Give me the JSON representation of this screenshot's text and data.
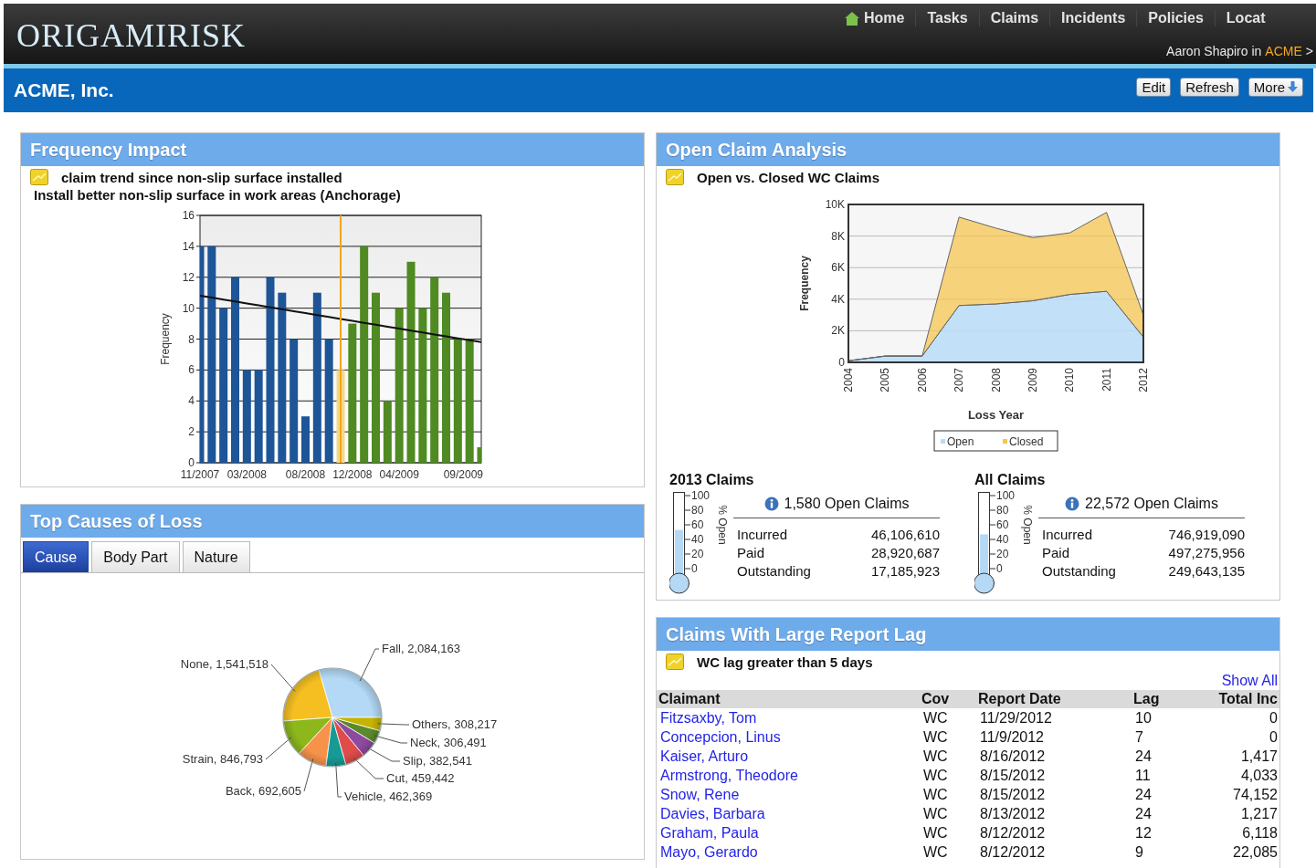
{
  "header": {
    "logo": "ORIGAMIRISK",
    "nav": [
      {
        "label": "Home"
      },
      {
        "label": "Tasks"
      },
      {
        "label": "Claims"
      },
      {
        "label": "Incidents"
      },
      {
        "label": "Policies"
      },
      {
        "label": "Locat"
      }
    ],
    "user": "Aaron Shapiro in",
    "org": "ACME",
    "trail": ">"
  },
  "company_bar": {
    "title": "ACME, Inc.",
    "buttons": [
      {
        "label": "Edit"
      },
      {
        "label": "Refresh"
      },
      {
        "label": "More",
        "menu": true
      }
    ]
  },
  "frequency_impact": {
    "title": "Frequency Impact",
    "note": "claim trend since non-slip surface installed",
    "subtitle": "Install better non-slip surface in work areas (Anchorage)",
    "chart_data": {
      "type": "bar",
      "ylabel": "Frequency",
      "grid": true,
      "categories": [
        "11/2007",
        null,
        null,
        null,
        "03/2008",
        null,
        null,
        null,
        null,
        "08/2008",
        null,
        null,
        null,
        "12/2008",
        null,
        null,
        null,
        "04/2009",
        null,
        null,
        null,
        null,
        "09/2009",
        null,
        null
      ],
      "ylim": [
        0,
        16
      ],
      "series": [
        {
          "color": "#1d5597",
          "values": [
            14,
            14,
            10,
            12,
            6,
            6,
            12,
            11,
            8,
            3,
            11,
            8,
            null,
            null,
            null,
            null,
            null,
            null,
            null,
            null,
            null,
            null,
            null,
            null,
            null
          ]
        },
        {
          "color": "#f3d98a",
          "values": [
            null,
            null,
            null,
            null,
            null,
            null,
            null,
            null,
            null,
            null,
            null,
            null,
            6,
            null,
            null,
            null,
            null,
            null,
            null,
            null,
            null,
            null,
            null,
            null,
            null
          ]
        },
        {
          "color": "#4f8a22",
          "values": [
            null,
            null,
            null,
            null,
            null,
            null,
            null,
            null,
            null,
            null,
            null,
            null,
            null,
            9,
            14,
            11,
            4,
            10,
            13,
            10,
            12,
            11,
            8,
            8,
            1
          ]
        },
        {
          "type": "line",
          "color": "#111111",
          "values": [
            10.8,
            10.68,
            10.55,
            10.43,
            10.3,
            10.18,
            10.05,
            9.93,
            9.8,
            9.68,
            9.55,
            9.43,
            9.3,
            9.18,
            9.05,
            8.93,
            8.8,
            8.68,
            8.55,
            8.43,
            8.3,
            8.18,
            8.05,
            7.93,
            7.8
          ]
        }
      ],
      "yticks": [
        {
          "value": 0,
          "label": "0"
        },
        {
          "value": 2,
          "label": "2"
        },
        {
          "value": 4,
          "label": "4"
        },
        {
          "value": 6,
          "label": "6"
        },
        {
          "value": 8,
          "label": "8"
        },
        {
          "value": 10,
          "label": "10"
        },
        {
          "value": 12,
          "label": "12"
        },
        {
          "value": 14,
          "label": "14"
        },
        {
          "value": 16,
          "label": "16"
        }
      ]
    }
  },
  "open_claim_analysis": {
    "title": "Open Claim Analysis",
    "note": "Open vs. Closed WC Claims",
    "chart_data": {
      "type": "area",
      "stacked": true,
      "grid": true,
      "legend": true,
      "xlabel": "Loss Year",
      "ylabel": "Frequency",
      "x": [
        2004,
        2005,
        2006,
        2007,
        2008,
        2009,
        2010,
        2011,
        2012
      ],
      "xlim": [
        2004,
        2012
      ],
      "ylim": [
        0,
        10000
      ],
      "series": [
        {
          "name": "Open",
          "color": "#b8dcf7",
          "values": [
            100,
            400,
            400,
            3600,
            3700,
            3900,
            4300,
            4500,
            1600
          ]
        },
        {
          "name": "Closed",
          "color": "#f6c650",
          "values": [
            0,
            0,
            0,
            5600,
            4800,
            4000,
            3900,
            5000,
            1400
          ]
        }
      ],
      "xticks": [
        2004,
        2005,
        2006,
        2007,
        2008,
        2009,
        2010,
        2011,
        2012
      ],
      "yticks": [
        {
          "value": 0,
          "label": "0"
        },
        {
          "value": 2000,
          "label": "2K"
        },
        {
          "value": 4000,
          "label": "4K"
        },
        {
          "value": 6000,
          "label": "6K"
        },
        {
          "value": 8000,
          "label": "8K"
        },
        {
          "value": 10000,
          "label": "10K"
        }
      ]
    },
    "gauges": [
      {
        "title": "2013 Claims",
        "level": 0.53,
        "scale": [
          "100",
          "80",
          "60",
          "40",
          "20",
          "0"
        ],
        "axis_label": "% Open",
        "open_claims": "1,580 Open Claims",
        "rows": [
          {
            "label": "Incurred",
            "value": "46,106,610"
          },
          {
            "label": "Paid",
            "value": "28,920,687"
          },
          {
            "label": "Outstanding",
            "value": "17,185,923"
          }
        ]
      },
      {
        "title": "All Claims",
        "level": 0.47,
        "scale": [
          "100",
          "80",
          "60",
          "40",
          "20",
          "0"
        ],
        "axis_label": "% Open",
        "open_claims": "22,572 Open Claims",
        "rows": [
          {
            "label": "Incurred",
            "value": "746,919,090"
          },
          {
            "label": "Paid",
            "value": "497,275,956"
          },
          {
            "label": "Outstanding",
            "value": "249,643,135"
          }
        ]
      }
    ]
  },
  "top_causes": {
    "title": "Top Causes of Loss",
    "tabs": [
      {
        "label": "Cause",
        "selected": true
      },
      {
        "label": "Body Part",
        "selected": false
      },
      {
        "label": "Nature",
        "selected": false
      }
    ],
    "chart_data": {
      "type": "pie",
      "values": [
        2084163,
        1541518,
        846793,
        692605,
        462369,
        459442,
        382541,
        306491,
        308217
      ],
      "colors": [
        "#b3d9f6",
        "#f5bf22",
        "#8cb81c",
        "#f7924a",
        "#179a94",
        "#e04c4c",
        "#8d4a9e",
        "#5b8a2c",
        "#c4b300"
      ],
      "value_labels": [
        "Fall, 2,084,163",
        "None, 1,541,518",
        "Strain, 846,793",
        "Back, 692,605",
        "Vehicle, 462,369",
        "Cut, 459,442",
        "Slip, 382,541",
        "Neck, 306,491",
        "Others, 308,217"
      ]
    }
  },
  "report_lag": {
    "title": "Claims With Large Report Lag",
    "note": "WC lag greater than 5 days",
    "show_all": "Show All",
    "columns": [
      "Claimant",
      "Cov",
      "Report Date",
      "Lag",
      "Total Inc"
    ],
    "rows": [
      [
        "Fitzsaxby, Tom",
        "WC",
        "11/29/2012",
        "10",
        "0"
      ],
      [
        "Concepcion, Linus",
        "WC",
        "11/9/2012",
        "7",
        "0"
      ],
      [
        "Kaiser, Arturo",
        "WC",
        "8/16/2012",
        "24",
        "1,417"
      ],
      [
        "Armstrong, Theodore",
        "WC",
        "8/15/2012",
        "11",
        "4,033"
      ],
      [
        "Snow, Rene",
        "WC",
        "8/15/2012",
        "24",
        "74,152"
      ],
      [
        "Davies, Barbara",
        "WC",
        "8/13/2012",
        "24",
        "1,217"
      ],
      [
        "Graham, Paula",
        "WC",
        "8/12/2012",
        "12",
        "6,118"
      ],
      [
        "Mayo, Gerardo",
        "WC",
        "8/12/2012",
        "9",
        "22,085"
      ]
    ]
  }
}
